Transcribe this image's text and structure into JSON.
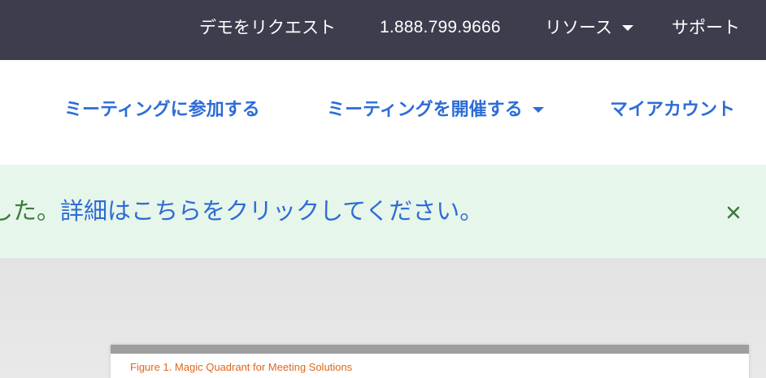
{
  "top_bar": {
    "request_demo": "デモをリクエスト",
    "phone": "1.888.799.9666",
    "resources": "リソース",
    "support": "サポート"
  },
  "main_nav": {
    "join_meeting": "ミーティングに参加する",
    "host_meeting": "ミーティングを開催する",
    "my_account": "マイアカウント"
  },
  "notice": {
    "prefix": "ました。",
    "link": "詳細はこちらをクリックしてください。",
    "close_symbol": "×"
  },
  "figure": {
    "caption": "Figure 1. Magic Quadrant for Meeting Solutions"
  },
  "colors": {
    "top_bar_bg": "#3d3d4e",
    "nav_link": "#2d6cd6",
    "notice_bg": "#e7f6ea",
    "notice_text": "#3e7a3c",
    "caption": "#e0661f"
  },
  "icons": {
    "resources_dropdown": "chevron-down-icon",
    "host_dropdown": "chevron-down-icon",
    "notice_close": "close-icon"
  }
}
